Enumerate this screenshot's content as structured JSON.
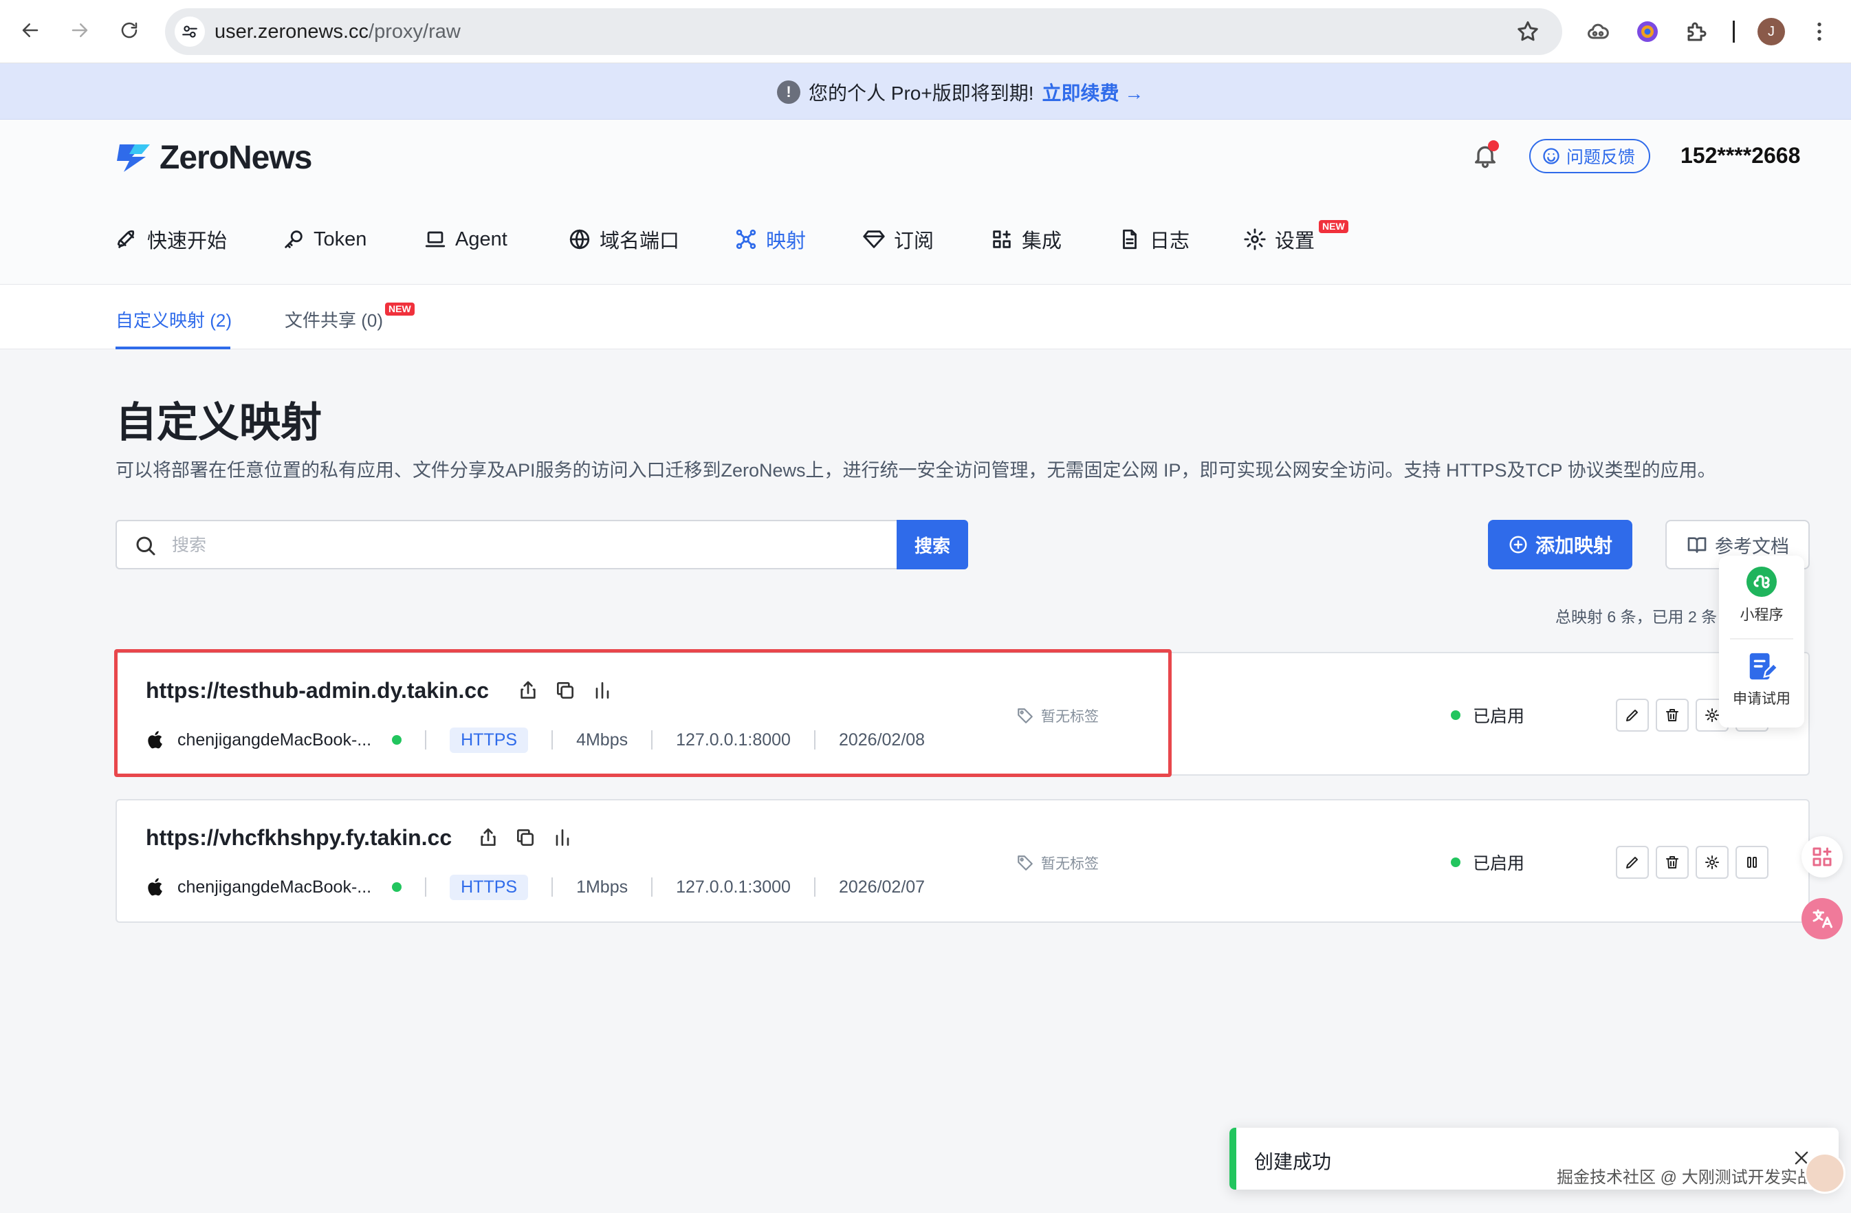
{
  "browser": {
    "url_host": "user.zeronews.cc",
    "url_path": "/proxy/raw",
    "profile_initial": "J"
  },
  "banner": {
    "message": "您的个人 Pro+版即将到期!",
    "renew_link": "立即续费 →"
  },
  "header": {
    "logo_text": "ZeroNews",
    "feedback_label": "问题反馈",
    "user_phone": "152****2668",
    "nav": [
      {
        "label": "快速开始",
        "icon": "rocket-icon"
      },
      {
        "label": "Token",
        "icon": "key-icon"
      },
      {
        "label": "Agent",
        "icon": "laptop-icon"
      },
      {
        "label": "域名端口",
        "icon": "globe-icon"
      },
      {
        "label": "映射",
        "icon": "network-icon",
        "active": true
      },
      {
        "label": "订阅",
        "icon": "diamond-icon"
      },
      {
        "label": "集成",
        "icon": "apps-icon"
      },
      {
        "label": "日志",
        "icon": "document-icon"
      },
      {
        "label": "设置",
        "icon": "gear-icon",
        "badge": "NEW"
      }
    ]
  },
  "subtabs": [
    {
      "label": "自定义映射 (2)",
      "active": true
    },
    {
      "label": "文件共享 (0)",
      "badge": "NEW"
    }
  ],
  "main": {
    "title": "自定义映射",
    "description": "可以将部署在任意位置的私有应用、文件分享及API服务的访问入口迁移到ZeroNews上，进行统一安全访问管理，无需固定公网 IP，即可实现公网安全访问。支持 HTTPS及TCP 协议类型的应用。",
    "search_placeholder": "搜索",
    "search_button": "搜索",
    "add_button": "添加映射",
    "docs_button": "参考文档",
    "summary": "总映射 6 条，已用 2 条"
  },
  "mappings": [
    {
      "url": "https://testhub-admin.dy.takin.cc",
      "device": "chenjigangdeMacBook-...",
      "protocol": "HTTPS",
      "bandwidth": "4Mbps",
      "target": "127.0.0.1:8000",
      "date": "2026/02/08",
      "tag": "暂无标签",
      "status": "已启用"
    },
    {
      "url": "https://vhcfkhshpy.fy.takin.cc",
      "device": "chenjigangdeMacBook-...",
      "protocol": "HTTPS",
      "bandwidth": "1Mbps",
      "target": "127.0.0.1:3000",
      "date": "2026/02/07",
      "tag": "暂无标签",
      "status": "已启用"
    }
  ],
  "float_panel": {
    "mini_program": "小程序",
    "apply_trial": "申请试用"
  },
  "toast": {
    "message": "创建成功"
  },
  "watermark": "掘金技术社区 @ 大刚测试开发实战",
  "colors": {
    "accent": "#2f6bea",
    "success": "#22c55e",
    "highlight": "#e8474c",
    "banner_bg": "#dee6fb"
  }
}
